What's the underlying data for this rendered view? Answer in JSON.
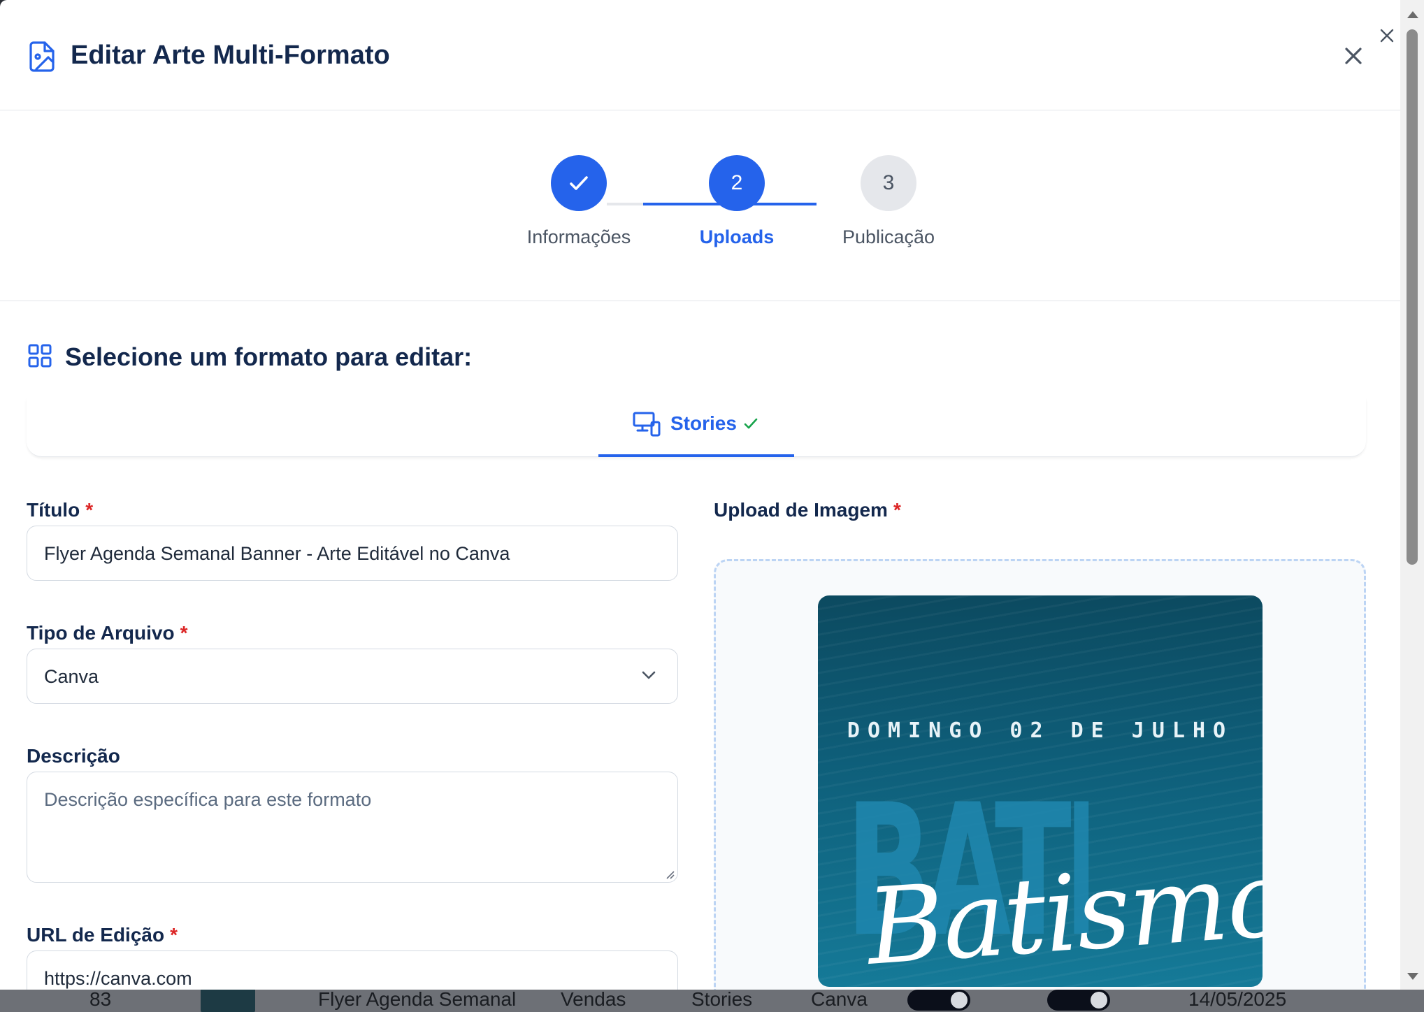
{
  "modal": {
    "title": "Editar Arte Multi-Formato"
  },
  "stepper": {
    "steps": [
      {
        "label": "Informações",
        "status": "completed",
        "number": "1"
      },
      {
        "label": "Uploads",
        "status": "active",
        "number": "2"
      },
      {
        "label": "Publicação",
        "status": "pending",
        "number": "3"
      }
    ]
  },
  "format_section": {
    "title": "Selecione um formato para editar:",
    "tabs": [
      {
        "label": "Stories",
        "selected": true,
        "completed": true
      }
    ]
  },
  "form": {
    "title": {
      "label": "Título",
      "required_mark": "*",
      "value": "Flyer Agenda Semanal Banner - Arte  Editável no Canva"
    },
    "file_type": {
      "label": "Tipo de Arquivo",
      "required_mark": "*",
      "value": "Canva"
    },
    "description": {
      "label": "Descrição",
      "placeholder": "Descrição específica para este formato"
    },
    "edit_url": {
      "label": "URL de Edição",
      "required_mark": "*",
      "value": "https://canva.com"
    },
    "image_upload": {
      "label": "Upload de Imagem",
      "required_mark": "*",
      "preview": {
        "date_text": "DOMINGO 02 DE JULHO",
        "block_text": "BATISMO",
        "script_text": "Batismo"
      }
    }
  },
  "background_table_row": {
    "id": "83",
    "name": "Flyer Agenda Semanal",
    "category": "Vendas",
    "format": "Stories",
    "type": "Canva",
    "date": "14/05/2025"
  },
  "colors": {
    "primary": "#2563eb",
    "title_text": "#13284d",
    "required": "#dc2626",
    "success_check": "#16a34a",
    "pending_step": "#e5e7eb"
  }
}
